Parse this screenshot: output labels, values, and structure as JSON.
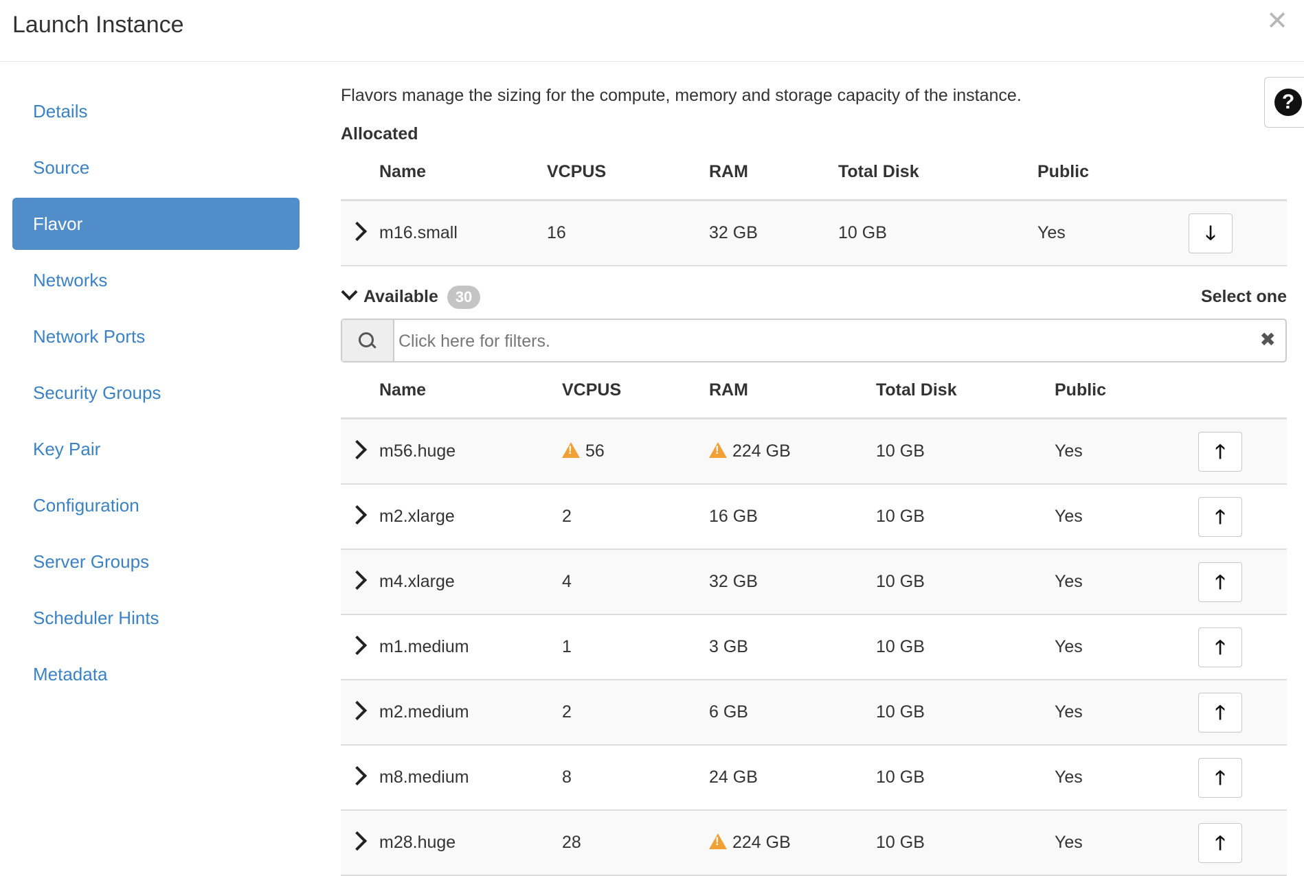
{
  "modal": {
    "title": "Launch Instance",
    "close_glyph": "✕"
  },
  "sidebar": {
    "items": [
      {
        "label": "Details"
      },
      {
        "label": "Source"
      },
      {
        "label": "Flavor"
      },
      {
        "label": "Networks"
      },
      {
        "label": "Network Ports"
      },
      {
        "label": "Security Groups"
      },
      {
        "label": "Key Pair"
      },
      {
        "label": "Configuration"
      },
      {
        "label": "Server Groups"
      },
      {
        "label": "Scheduler Hints"
      },
      {
        "label": "Metadata"
      }
    ],
    "active": "Flavor"
  },
  "main": {
    "intro": "Flavors manage the sizing for the compute, memory and storage capacity of the instance.",
    "help_glyph": "?",
    "allocated": {
      "label": "Allocated",
      "columns": [
        "Name",
        "VCPUS",
        "RAM",
        "Total Disk",
        "Public"
      ],
      "rows": [
        {
          "name": "m16.small",
          "vcpus": "16",
          "ram": "32 GB",
          "disk": "10 GB",
          "public": "Yes",
          "action_glyph": "🡓"
        }
      ]
    },
    "available": {
      "label": "Available",
      "count": "30",
      "select_hint": "Select one",
      "search_placeholder": "Click here for filters.",
      "clear_glyph": "✖",
      "columns": [
        "Name",
        "VCPUS",
        "RAM",
        "Total Disk",
        "Public"
      ],
      "rows": [
        {
          "name": "m56.huge",
          "vcpus": "56",
          "ram": "224 GB",
          "disk": "10 GB",
          "public": "Yes",
          "vcpus_warning": true,
          "ram_warning": true
        },
        {
          "name": "m2.xlarge",
          "vcpus": "2",
          "ram": "16 GB",
          "disk": "10 GB",
          "public": "Yes",
          "vcpus_warning": false,
          "ram_warning": false
        },
        {
          "name": "m4.xlarge",
          "vcpus": "4",
          "ram": "32 GB",
          "disk": "10 GB",
          "public": "Yes",
          "vcpus_warning": false,
          "ram_warning": false
        },
        {
          "name": "m1.medium",
          "vcpus": "1",
          "ram": "3 GB",
          "disk": "10 GB",
          "public": "Yes",
          "vcpus_warning": false,
          "ram_warning": false
        },
        {
          "name": "m2.medium",
          "vcpus": "2",
          "ram": "6 GB",
          "disk": "10 GB",
          "public": "Yes",
          "vcpus_warning": false,
          "ram_warning": false
        },
        {
          "name": "m8.medium",
          "vcpus": "8",
          "ram": "24 GB",
          "disk": "10 GB",
          "public": "Yes",
          "vcpus_warning": false,
          "ram_warning": false
        },
        {
          "name": "m28.huge",
          "vcpus": "28",
          "ram": "224 GB",
          "disk": "10 GB",
          "public": "Yes",
          "vcpus_warning": false,
          "ram_warning": true
        }
      ],
      "action_glyph": "🡑"
    }
  },
  "colors": {
    "link": "#3b82c4",
    "active_nav": "#518dc8",
    "warning": "#f0a035",
    "badge": "#c4c4c4"
  }
}
